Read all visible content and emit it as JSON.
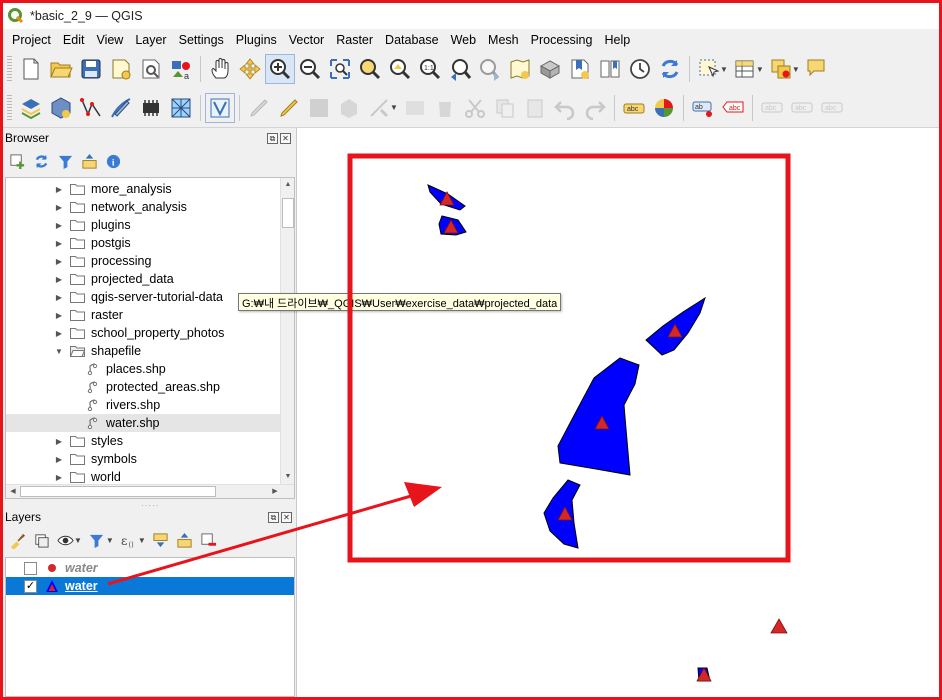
{
  "window": {
    "title": "*basic_2_9 — QGIS"
  },
  "menu": [
    "Project",
    "Edit",
    "View",
    "Layer",
    "Settings",
    "Plugins",
    "Vector",
    "Raster",
    "Database",
    "Web",
    "Mesh",
    "Processing",
    "Help"
  ],
  "browser": {
    "title": "Browser",
    "items": [
      {
        "label": "more_analysis",
        "kind": "folder"
      },
      {
        "label": "network_analysis",
        "kind": "folder"
      },
      {
        "label": "plugins",
        "kind": "folder"
      },
      {
        "label": "postgis",
        "kind": "folder"
      },
      {
        "label": "processing",
        "kind": "folder"
      },
      {
        "label": "projected_data",
        "kind": "folder"
      },
      {
        "label": "qgis-server-tutorial-data",
        "kind": "folder"
      },
      {
        "label": "raster",
        "kind": "folder"
      },
      {
        "label": "school_property_photos",
        "kind": "folder"
      },
      {
        "label": "shapefile",
        "kind": "folder-open"
      },
      {
        "label": "places.shp",
        "kind": "shp"
      },
      {
        "label": "protected_areas.shp",
        "kind": "shp"
      },
      {
        "label": "rivers.shp",
        "kind": "shp"
      },
      {
        "label": "water.shp",
        "kind": "shp",
        "selected": true
      },
      {
        "label": "styles",
        "kind": "folder"
      },
      {
        "label": "symbols",
        "kind": "folder"
      },
      {
        "label": "world",
        "kind": "folder"
      }
    ]
  },
  "tooltip": "G:₩내 드라이브₩_QGIS₩User₩exercise_data₩projected_data",
  "layers": {
    "title": "Layers",
    "items": [
      {
        "name": "water",
        "checked": false,
        "symbol": "point"
      },
      {
        "name": "water",
        "checked": true,
        "symbol": "polygon",
        "active": true
      }
    ]
  },
  "colors": {
    "water_fill": "#0000ff",
    "marker_fill": "#d62728",
    "highlight": "#e8141b",
    "selection": "#0a78d7"
  },
  "icons": {
    "toolbar1": [
      "new-project-icon",
      "open-project-icon",
      "save-project-icon",
      "new-print-layout-icon",
      "layout-manager-icon",
      "style-manager-icon",
      "pan-icon",
      "pan-to-selection-icon",
      "zoom-in-icon",
      "zoom-out-icon",
      "zoom-full-icon",
      "zoom-to-selection-icon",
      "zoom-to-layer-icon",
      "zoom-native-icon",
      "zoom-last-icon",
      "zoom-next-icon",
      "new-map-view-icon",
      "new-3d-map-view-icon",
      "new-bookmark-icon",
      "show-bookmarks-icon",
      "temporal-controller-icon",
      "refresh-icon",
      "select-feature-icon",
      "open-attribute-table-icon",
      "deselect-icon",
      "annotation-icon"
    ],
    "toolbar2": [
      "data-source-manager-icon",
      "new-geopackage-layer-icon",
      "digitize-icon",
      "vertex-tool-icon",
      "grass-icon",
      "mesh-icon",
      "virtual-layer-icon"
    ]
  }
}
